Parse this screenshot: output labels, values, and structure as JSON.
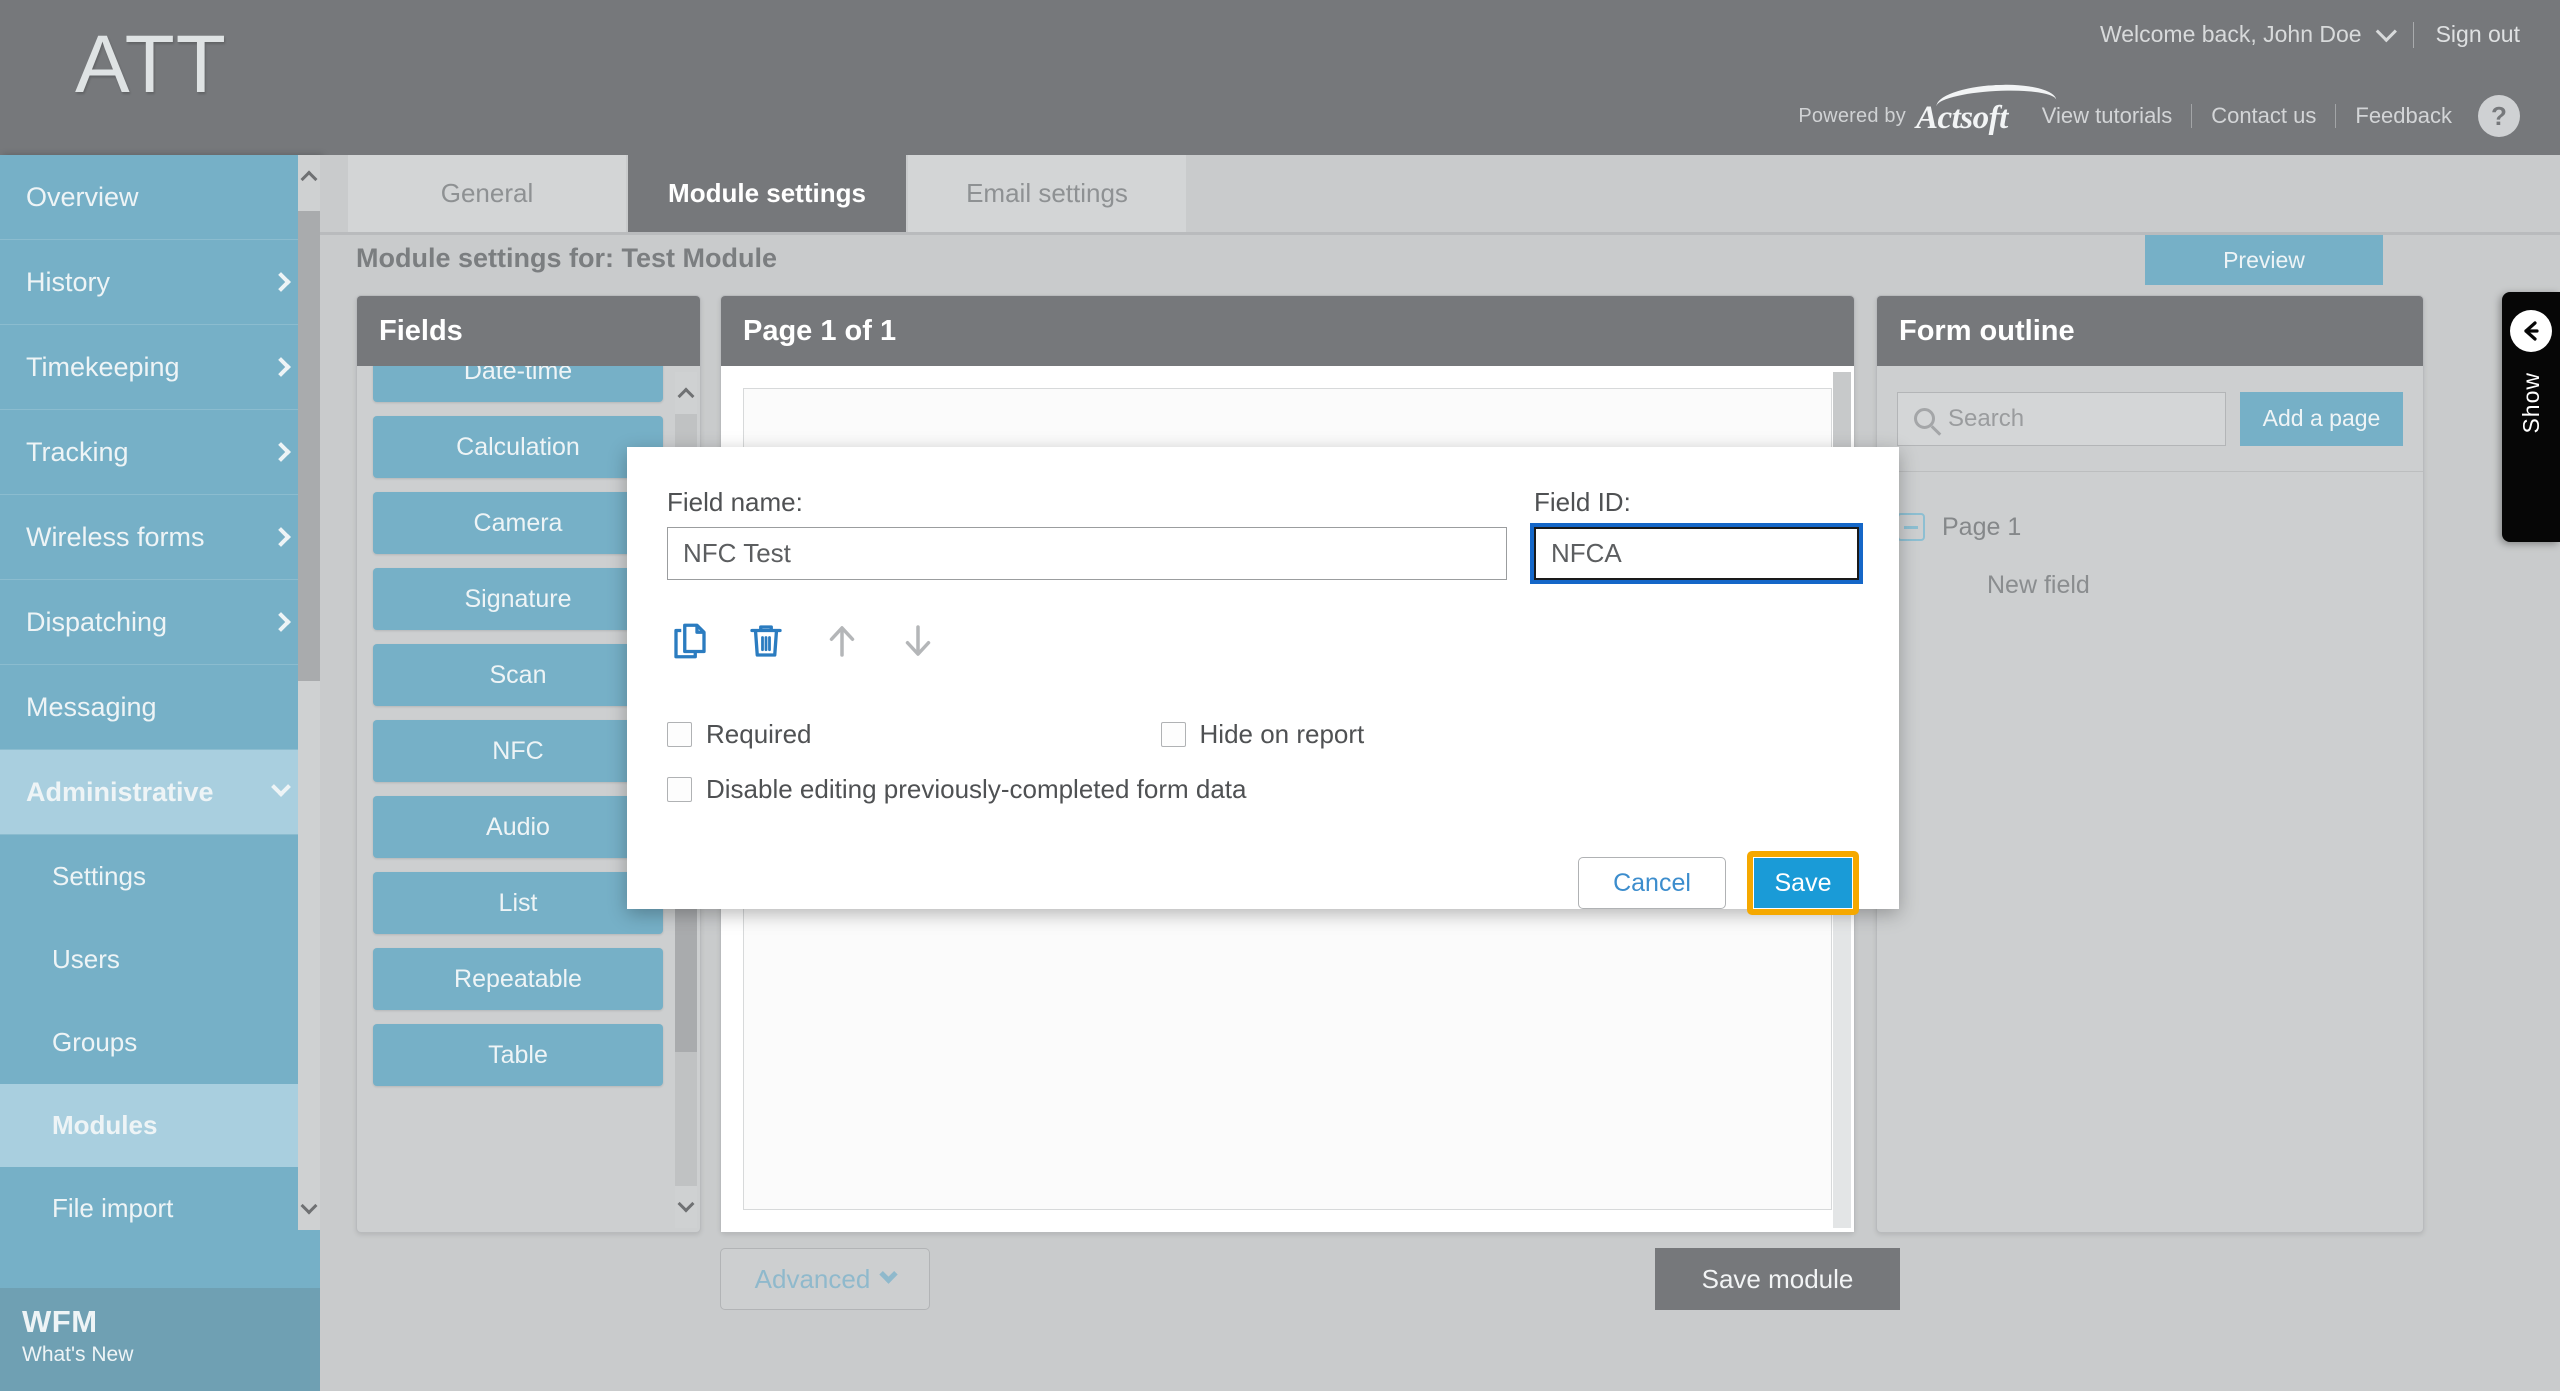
{
  "header": {
    "logo": "ATT",
    "welcome": "Welcome back, John Doe",
    "sign_out": "Sign out",
    "powered_by": "Powered by",
    "brand": "Actsoft",
    "links": [
      "View tutorials",
      "Contact us",
      "Feedback"
    ],
    "help": "?"
  },
  "sidebar": {
    "items": [
      {
        "label": "Overview",
        "chevron": "none"
      },
      {
        "label": "History",
        "chevron": "right"
      },
      {
        "label": "Timekeeping",
        "chevron": "right"
      },
      {
        "label": "Tracking",
        "chevron": "right"
      },
      {
        "label": "Wireless forms",
        "chevron": "right"
      },
      {
        "label": "Dispatching",
        "chevron": "right"
      },
      {
        "label": "Messaging",
        "chevron": "none"
      },
      {
        "label": "Administrative",
        "chevron": "down",
        "active": true
      },
      {
        "label": "Settings",
        "sub": true
      },
      {
        "label": "Users",
        "sub": true
      },
      {
        "label": "Groups",
        "sub": true
      },
      {
        "label": "Modules",
        "sub": true,
        "active": true
      },
      {
        "label": "File import",
        "sub": true
      }
    ],
    "footer": {
      "title": "WFM",
      "subtitle": "What's New"
    }
  },
  "tabs": [
    {
      "label": "General",
      "active": false
    },
    {
      "label": "Module settings",
      "active": true
    },
    {
      "label": "Email settings",
      "active": false
    }
  ],
  "main": {
    "page_title": "Module settings for: Test Module",
    "preview_label": "Preview",
    "advanced_label": "Advanced",
    "save_module_label": "Save module"
  },
  "fields_panel": {
    "title": "Fields",
    "items": [
      "Date-time",
      "Calculation",
      "Camera",
      "Signature",
      "Scan",
      "NFC",
      "Audio",
      "List",
      "Repeatable",
      "Table"
    ]
  },
  "page_panel": {
    "title": "Page 1 of 1"
  },
  "outline_panel": {
    "title": "Form outline",
    "search_placeholder": "Search",
    "search_value": "",
    "add_page_label": "Add a page",
    "tree": {
      "page_label": "Page 1",
      "child_label": "New field"
    }
  },
  "show_tab": {
    "label": "Show",
    "arrow": "←"
  },
  "modal": {
    "field_name_label": "Field name:",
    "field_name_value": "NFC Test",
    "field_id_label": "Field ID:",
    "field_id_value": "NFCA",
    "icons": [
      "copy-icon",
      "trash-icon",
      "move-up-icon",
      "move-down-icon"
    ],
    "checkboxes": [
      {
        "label": "Required",
        "checked": false
      },
      {
        "label": "Hide on report",
        "checked": false
      },
      {
        "label": "Disable editing previously-completed form data",
        "checked": false
      }
    ],
    "cancel_label": "Cancel",
    "save_label": "Save"
  },
  "colors": {
    "brand_blue": "#76b0c7",
    "header_gray": "#76787b",
    "accent_blue": "#1a9bd7",
    "highlight_orange": "#f5a800",
    "focus_blue": "#1567c8"
  }
}
